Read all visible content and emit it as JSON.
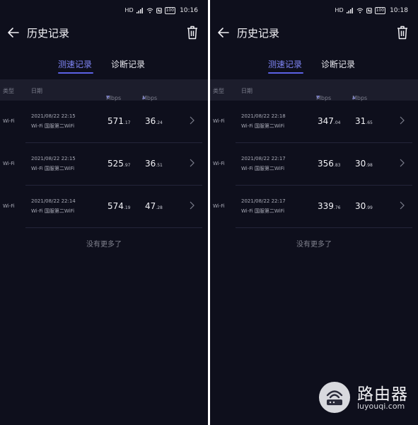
{
  "status": {
    "icons": [
      "hd-icon",
      "signal-icon",
      "wifi-icon",
      "nfc-icon",
      "battery-icon"
    ],
    "hd_label": "HD",
    "battery": "100"
  },
  "header": {
    "title": "历史记录"
  },
  "tabs": [
    {
      "label": "测速记录",
      "active": true
    },
    {
      "label": "诊断记录",
      "active": false
    }
  ],
  "table": {
    "columns": {
      "type": "类型",
      "date": "日期",
      "download": "Mbps",
      "upload": "Mbps"
    }
  },
  "screens": [
    {
      "time": "10:16",
      "rows": [
        {
          "type": "Wi-Fi",
          "date": "2021/08/22   22:15",
          "network": "Wi-Fi 国服第二WiFi",
          "down_int": "571",
          "down_dec": ".17",
          "up_int": "36",
          "up_dec": ".24"
        },
        {
          "type": "Wi-Fi",
          "date": "2021/08/22   22:15",
          "network": "Wi-Fi 国服第二WiFi",
          "down_int": "525",
          "down_dec": ".97",
          "up_int": "36",
          "up_dec": ".51"
        },
        {
          "type": "Wi-Fi",
          "date": "2021/08/22   22:14",
          "network": "Wi-Fi 国服第二WiFi",
          "down_int": "574",
          "down_dec": ".19",
          "up_int": "47",
          "up_dec": ".28"
        }
      ]
    },
    {
      "time": "10:18",
      "rows": [
        {
          "type": "Wi-Fi",
          "date": "2021/08/22   22:18",
          "network": "Wi-Fi 国服第二WiFi",
          "down_int": "347",
          "down_dec": ".04",
          "up_int": "31",
          "up_dec": ".65"
        },
        {
          "type": "Wi-Fi",
          "date": "2021/08/22   22:17",
          "network": "Wi-Fi 国服第二WiFi",
          "down_int": "356",
          "down_dec": ".83",
          "up_int": "30",
          "up_dec": ".98"
        },
        {
          "type": "Wi-Fi",
          "date": "2021/08/22   22:17",
          "network": "Wi-Fi 国服第二WiFi",
          "down_int": "339",
          "down_dec": ".76",
          "up_int": "30",
          "up_dec": ".99"
        }
      ]
    }
  ],
  "footer": {
    "no_more": "没有更多了"
  },
  "watermark": {
    "title": "路由器",
    "url": "luyouqi.com"
  },
  "colors": {
    "background": "#0e0f1c",
    "accent": "#7f85f5",
    "header_row": "#1c1d2c"
  }
}
